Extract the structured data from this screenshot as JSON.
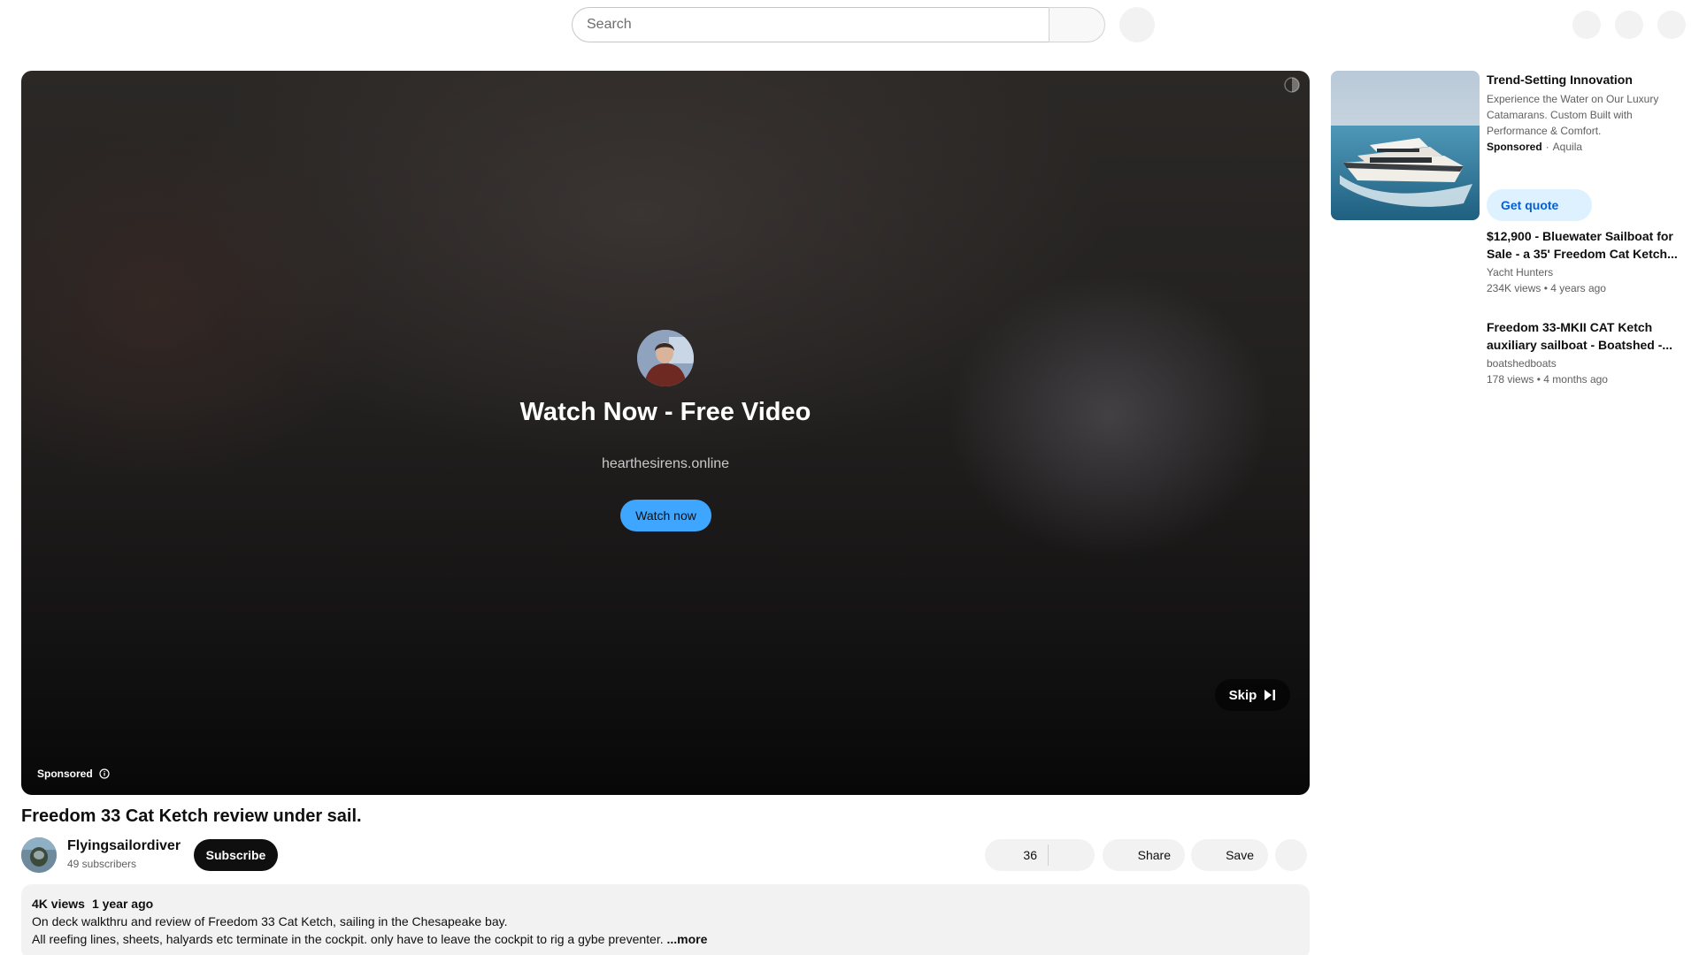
{
  "search": {
    "placeholder": "Search"
  },
  "player": {
    "ad_title": "Watch Now - Free Video",
    "ad_domain": "hearthesirens.online",
    "ad_cta": "Watch now",
    "skip_label": "Skip",
    "sponsored_label": "Sponsored"
  },
  "video": {
    "title": "Freedom 33 Cat Ketch review under sail.",
    "channel_name": "Flyingsailordiver",
    "subscribers": "49 subscribers",
    "subscribe_label": "Subscribe",
    "like_count": "36",
    "share_label": "Share",
    "save_label": "Save"
  },
  "description": {
    "views": "4K views",
    "age": "1 year ago",
    "line1": "On deck walkthru and review of Freedom 33 Cat Ketch, sailing in the Chesapeake bay.",
    "line2": "All reefing lines, sheets, halyards etc terminate in the cockpit.  only have to leave the cockpit to rig a gybe preventer.",
    "more_label": "...more"
  },
  "sidebar": {
    "ad": {
      "title": "Trend-Setting Innovation",
      "description": "Experience the Water on Our Luxury Catamarans. Custom Built with Performance & Comfort.",
      "sponsored": "Sponsored",
      "advertiser": "Aquila",
      "cta": "Get quote"
    },
    "recommendations": [
      {
        "title": "$12,900 - Bluewater Sailboat for Sale - a 35' Freedom Cat Ketch...",
        "channel": "Yacht Hunters",
        "views": "234K views",
        "age": "4 years ago"
      },
      {
        "title": "Freedom 33-MKII CAT Ketch auxiliary sailboat - Boatshed -...",
        "channel": "boatshedboats",
        "views": "178 views",
        "age": "4 months ago"
      }
    ]
  },
  "colors": {
    "accent_blue": "#3ea6ff",
    "link_blue": "#065fd4",
    "quote_bg": "#def1ff",
    "pill_bg": "#f2f2f2"
  }
}
